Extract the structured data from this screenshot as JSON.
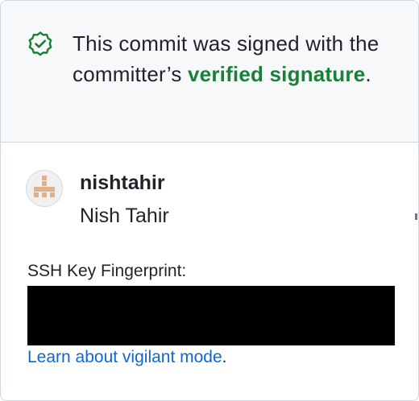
{
  "verification": {
    "message_before": "This commit was signed with the committer’s ",
    "link_text": "verified signature",
    "message_after": ".",
    "accent_color": "#1a7f37",
    "icon": "verified-check-icon"
  },
  "committer": {
    "avatar_icon": "identicon-avatar",
    "username": "nishtahir",
    "full_name": "Nish Tahir"
  },
  "key": {
    "label": "SSH Key Fingerprint:",
    "value": ""
  },
  "learn_more": {
    "link_text": "Learn about vigilant mode",
    "suffix": ".",
    "link_color": "#0969da"
  }
}
